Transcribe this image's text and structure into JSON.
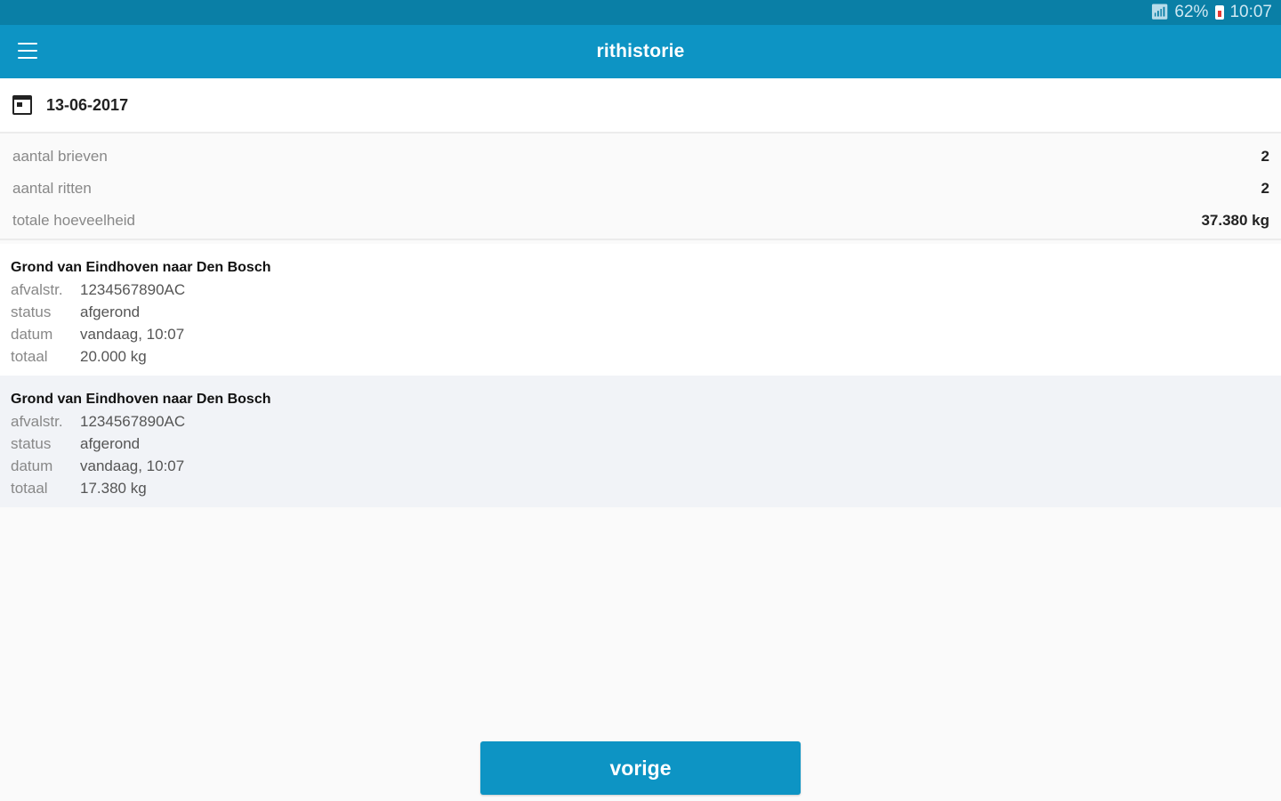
{
  "status_bar": {
    "battery_percent": "62%",
    "time": "10:07",
    "icons": [
      "signal-icon",
      "battery-icon"
    ]
  },
  "app_bar": {
    "title": "rithistorie",
    "menu_icon": "hamburger-menu-icon"
  },
  "date_picker": {
    "icon": "calendar-icon",
    "value": "13-06-2017"
  },
  "summary": [
    {
      "label": "aantal brieven",
      "value": "2"
    },
    {
      "label": "aantal ritten",
      "value": "2"
    },
    {
      "label": "totale hoeveelheid",
      "value": "37.380 kg"
    }
  ],
  "trips": [
    {
      "title": "Grond van Eindhoven naar Den Bosch",
      "fields": [
        {
          "key": "afvalstr.",
          "value": "1234567890AC"
        },
        {
          "key": "status",
          "value": "afgerond"
        },
        {
          "key": "datum",
          "value": "vandaag, 10:07"
        },
        {
          "key": "totaal",
          "value": "20.000 kg"
        }
      ]
    },
    {
      "title": "Grond van Eindhoven naar Den Bosch",
      "fields": [
        {
          "key": "afvalstr.",
          "value": "1234567890AC"
        },
        {
          "key": "status",
          "value": "afgerond"
        },
        {
          "key": "datum",
          "value": "vandaag, 10:07"
        },
        {
          "key": "totaal",
          "value": "17.380 kg"
        }
      ]
    }
  ],
  "footer": {
    "button_label": "vorige"
  },
  "colors": {
    "status_bar": "#0a7fa6",
    "app_bar": "#0d94c4",
    "button": "#0d94c4",
    "background": "#fafafa"
  }
}
